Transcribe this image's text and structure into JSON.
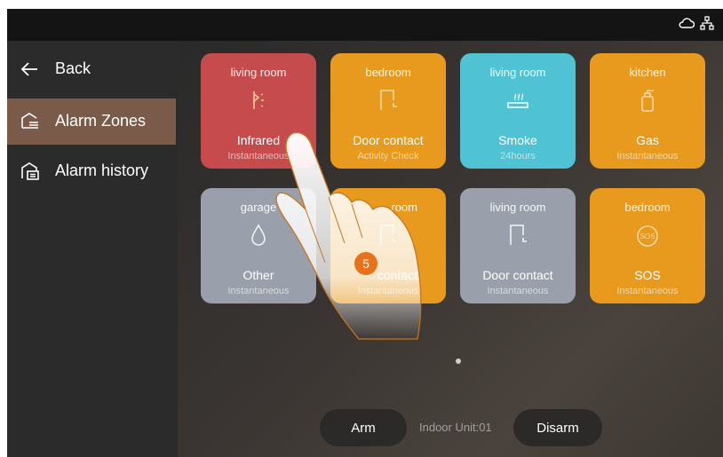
{
  "nav": {
    "back_label": "Back",
    "items": [
      {
        "label": "Alarm Zones",
        "active": true,
        "icon": "alarm-zones-icon"
      },
      {
        "label": "Alarm history",
        "active": false,
        "icon": "alarm-history-icon"
      }
    ]
  },
  "status_icons": [
    "cloud-icon",
    "network-icon"
  ],
  "zones": [
    {
      "room": "living room",
      "type": "Infrared",
      "mode": "Instantaneous",
      "color": "#c64b4d",
      "icon": "infrared-icon"
    },
    {
      "room": "bedroom",
      "type": "Door contact",
      "mode": "Activity Check",
      "color": "#e89a1f",
      "icon": "door-contact-icon"
    },
    {
      "room": "living room",
      "type": "Smoke",
      "mode": "24hours",
      "color": "#4fc3d3",
      "icon": "smoke-icon"
    },
    {
      "room": "kitchen",
      "type": "Gas",
      "mode": "Instantaneous",
      "color": "#e89a1f",
      "icon": "gas-icon"
    },
    {
      "room": "garage",
      "type": "Other",
      "mode": "Instantaneous",
      "color": "#9aa0ab",
      "icon": "drop-icon"
    },
    {
      "room": "room",
      "type": "contact",
      "mode": "Instantaneous",
      "color": "#e89a1f",
      "icon": "door-contact-icon"
    },
    {
      "room": "living room",
      "type": "Door contact",
      "mode": "Instantaneous",
      "color": "#9aa0ab",
      "icon": "door-contact-icon"
    },
    {
      "room": "bedroom",
      "type": "SOS",
      "mode": "Instantaneous",
      "color": "#e89a1f",
      "icon": "sos-icon"
    }
  ],
  "bottom": {
    "arm_label": "Arm",
    "unit_label": "Indoor Unit:01",
    "disarm_label": "Disarm"
  },
  "step_badge": "5",
  "colors": {
    "badge": "#e8711c",
    "active_nav": "#7a5b4a"
  }
}
